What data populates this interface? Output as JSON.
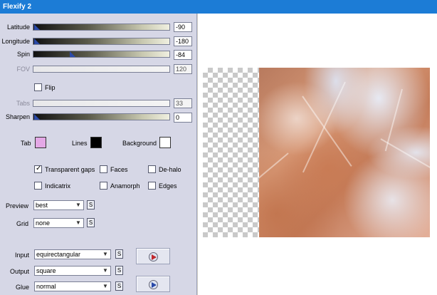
{
  "window": {
    "title": "Flexify 2"
  },
  "sliders": [
    {
      "key": "latitude",
      "label": "Latitude",
      "value": "-90",
      "level": 0.0,
      "enabled": true
    },
    {
      "key": "longitude",
      "label": "Longitude",
      "value": "-180",
      "level": 0.0,
      "enabled": true
    },
    {
      "key": "spin",
      "label": "Spin",
      "value": "-84",
      "level": 0.27,
      "enabled": true
    },
    {
      "key": "fov",
      "label": "FOV",
      "value": "120",
      "level": null,
      "enabled": false
    }
  ],
  "flip": {
    "label": "Flip",
    "checked": false
  },
  "tabs_slider": {
    "label": "Tabs",
    "value": "33",
    "enabled": false
  },
  "sharpen_slider": {
    "label": "Sharpen",
    "value": "0",
    "level": 0.0,
    "enabled": true
  },
  "colors": {
    "tab": {
      "label": "Tab",
      "hex": "#e4a8e6"
    },
    "lines": {
      "label": "Lines",
      "hex": "#000000"
    },
    "background": {
      "label": "Background",
      "hex": "#ffffff"
    }
  },
  "options": {
    "transparent_gaps": {
      "label": "Transparent gaps",
      "checked": true
    },
    "faces": {
      "label": "Faces",
      "checked": false
    },
    "de_halo": {
      "label": "De-halo",
      "checked": false
    },
    "indicatrix": {
      "label": "Indicatrix",
      "checked": false
    },
    "anamorph": {
      "label": "Anamorph",
      "checked": false
    },
    "edges": {
      "label": "Edges",
      "checked": false
    }
  },
  "dropdowns": {
    "preview": {
      "label": "Preview",
      "value": "best"
    },
    "grid": {
      "label": "Grid",
      "value": "none"
    },
    "input": {
      "label": "Input",
      "value": "equirectangular"
    },
    "output": {
      "label": "Output",
      "value": "square"
    },
    "glue": {
      "label": "Glue",
      "value": "normal"
    }
  },
  "small_button_label": "S",
  "icons": {
    "input_play": "play-red-icon",
    "glue_play": "play-blue-icon",
    "dropdown_arrow": "chevron-down-icon"
  }
}
